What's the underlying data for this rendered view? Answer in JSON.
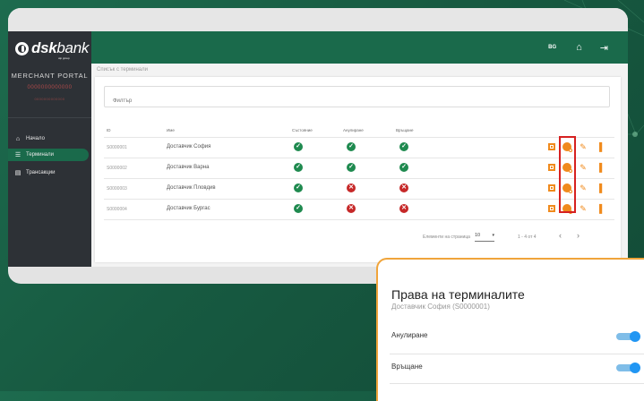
{
  "header": {
    "language": "BG",
    "home_icon": "home-icon",
    "logout_icon": "logout-icon"
  },
  "sidebar": {
    "logo_text_bold": "dsk",
    "logo_text_light": "bank",
    "logo_sub": "otp group",
    "portal_title": "MERCHANT PORTAL",
    "merchant_id": "0000000000000",
    "merchant_id_small": "0000000000000",
    "items": [
      {
        "label": "Начало",
        "icon": "home-icon",
        "active": false
      },
      {
        "label": "Терминали",
        "icon": "list-icon",
        "active": true
      },
      {
        "label": "Трансакции",
        "icon": "receipt-icon",
        "active": false
      }
    ]
  },
  "main": {
    "breadcrumb": "Списък с терминали",
    "filter_placeholder": "Филтър",
    "columns": [
      "ID",
      "Име",
      "Състояние",
      "Анулиране",
      "Връщане"
    ],
    "rows": [
      {
        "id": "S0000001",
        "name": "Доставчик София",
        "state": true,
        "void": true,
        "refund": true
      },
      {
        "id": "S0000002",
        "name": "Доставчик Варна",
        "state": true,
        "void": true,
        "refund": true
      },
      {
        "id": "S0000003",
        "name": "Доставчик Пловдив",
        "state": true,
        "void": false,
        "refund": false
      },
      {
        "id": "S0000004",
        "name": "Доставчик Бургас",
        "state": true,
        "void": false,
        "refund": false
      }
    ],
    "pagination": {
      "per_page_label": "Елементи на страница",
      "per_page_value": "10",
      "range": "1 - 4 от 4",
      "prev": "‹",
      "next": "›"
    }
  },
  "popup": {
    "title": "Права на терминалите",
    "subtitle": "Доставчик София (S0000001)",
    "items": [
      {
        "label": "Анулиране",
        "enabled": true
      },
      {
        "label": "Връщане",
        "enabled": true
      }
    ]
  },
  "colors": {
    "brand_green": "#1a6a4b",
    "action_orange": "#f08a1c",
    "status_ok": "#1f8a4f",
    "status_no": "#c62828",
    "highlight_red": "#d62020",
    "toggle_blue": "#2196f3",
    "popup_border": "#f0a43a"
  }
}
